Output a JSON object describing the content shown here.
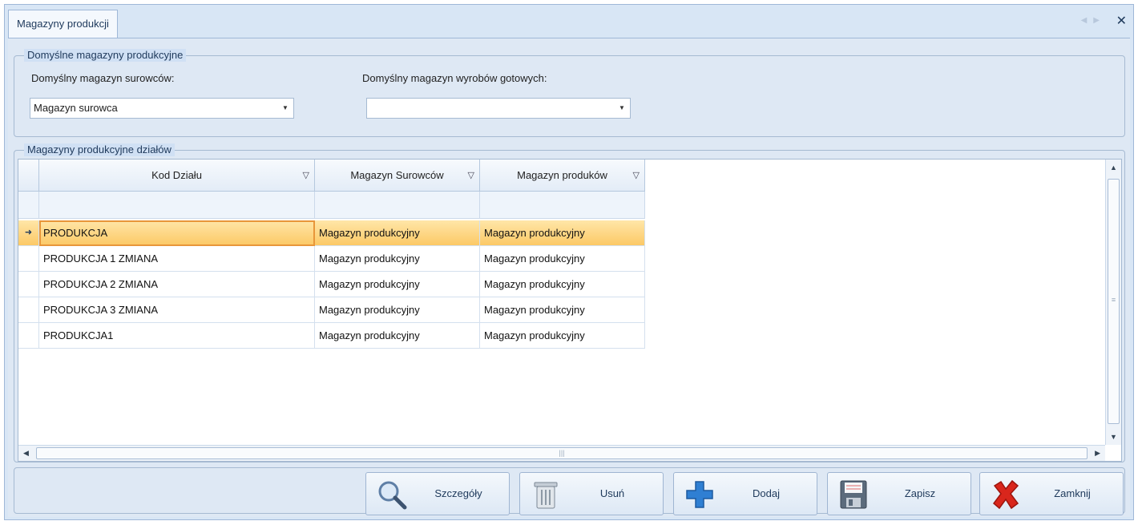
{
  "tab": {
    "title": "Magazyny produkcji"
  },
  "default_group": {
    "title": "Domyślne magazyny produkcyjne",
    "raw_label": "Domyślny magazyn surowców:",
    "raw_value": "Magazyn surowca",
    "finished_label": "Domyślny magazyn wyrobów gotowych:",
    "finished_value": ""
  },
  "dept_group": {
    "title": "Magazyny produkcyjne działów",
    "columns": [
      "Kod Działu",
      "Magazyn Surowców",
      "Magazyn produków"
    ],
    "rows": [
      {
        "kod": "PRODUKCJA",
        "surowce": "Magazyn produkcyjny",
        "produkty": "Magazyn produkcyjny",
        "selected": true
      },
      {
        "kod": "PRODUKCJA 1 ZMIANA",
        "surowce": "Magazyn produkcyjny",
        "produkty": "Magazyn produkcyjny"
      },
      {
        "kod": "PRODUKCJA 2 ZMIANA",
        "surowce": "Magazyn produkcyjny",
        "produkty": "Magazyn produkcyjny"
      },
      {
        "kod": "PRODUKCJA 3 ZMIANA",
        "surowce": "Magazyn produkcyjny",
        "produkty": "Magazyn produkcyjny"
      },
      {
        "kod": "PRODUKCJA1",
        "surowce": "Magazyn produkcyjny",
        "produkty": "Magazyn produkcyjny"
      }
    ]
  },
  "buttons": {
    "details": "Szczegóły",
    "delete": "Usuń",
    "add": "Dodaj",
    "save": "Zapisz",
    "close": "Zamknij"
  },
  "icons": {
    "details": "magnifier-icon",
    "delete": "trash-can-icon",
    "add": "plus-icon",
    "save": "floppy-disk-icon",
    "close": "red-x-icon"
  },
  "colors": {
    "selected_row": "#fcc966",
    "focus_border": "#e8963a",
    "accent": "#1e395b"
  }
}
